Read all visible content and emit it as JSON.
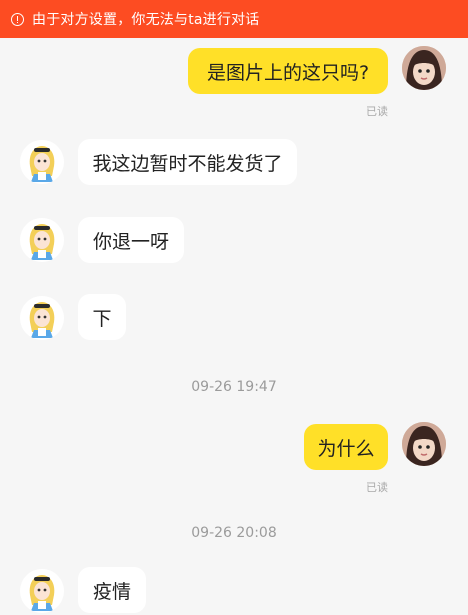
{
  "banner": {
    "icon": "exclamation-circle-icon",
    "text": "由于对方设置，你无法与ta进行对话",
    "color": "#fd4c22"
  },
  "messages": [
    {
      "from": "me",
      "text": "是图片上的这只吗?",
      "status": "已读"
    },
    {
      "from": "them",
      "text": "我这边暂时不能发货了"
    },
    {
      "from": "them",
      "text": "你退一呀"
    },
    {
      "from": "them",
      "text": "下"
    },
    {
      "timestamp": "09-26 19:47"
    },
    {
      "from": "me",
      "text": "为什么",
      "status": "已读"
    },
    {
      "timestamp": "09-26 20:08"
    },
    {
      "from": "them",
      "text": "疫情"
    }
  ],
  "colors": {
    "my_bubble": "#ffe028",
    "their_bubble": "#ffffff",
    "background": "#f6f6f6"
  }
}
